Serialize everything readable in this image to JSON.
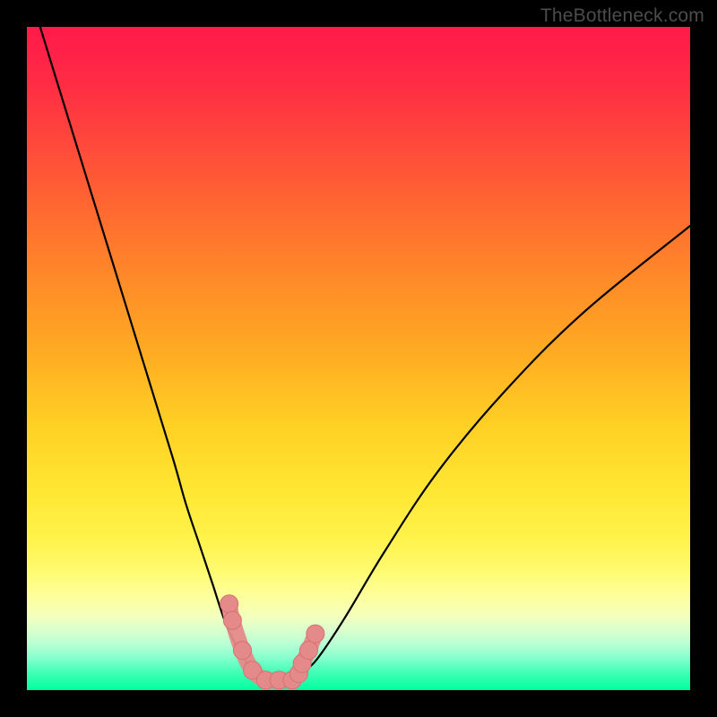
{
  "watermark": "TheBottleneck.com",
  "chart_data": {
    "type": "line",
    "title": "",
    "xlabel": "",
    "ylabel": "",
    "xlim": [
      0,
      100
    ],
    "ylim": [
      0,
      100
    ],
    "series": [
      {
        "name": "left-curve",
        "x": [
          2,
          6,
          10,
          14,
          18,
          22,
          24,
          26,
          28,
          30,
          32,
          34,
          36,
          38
        ],
        "y": [
          100,
          87,
          74,
          61,
          48,
          35,
          28,
          22,
          16,
          10,
          6,
          3,
          1.5,
          1.5
        ]
      },
      {
        "name": "right-curve",
        "x": [
          38,
          40,
          42,
          44,
          48,
          54,
          62,
          72,
          84,
          100
        ],
        "y": [
          1.5,
          1.5,
          3,
          5,
          11,
          21,
          33,
          45,
          57,
          70
        ]
      },
      {
        "name": "marker-cluster",
        "x": [
          30.5,
          31.0,
          32.5,
          34,
          36,
          38,
          40,
          41,
          41.5,
          42.5,
          43.5
        ],
        "y": [
          13,
          10.5,
          6,
          3,
          1.5,
          1.5,
          1.5,
          2.5,
          4,
          6,
          8.5
        ]
      }
    ],
    "colors": {
      "curve": "#000000",
      "marker_fill": "#e58a8a",
      "marker_stroke": "#d87070"
    }
  }
}
